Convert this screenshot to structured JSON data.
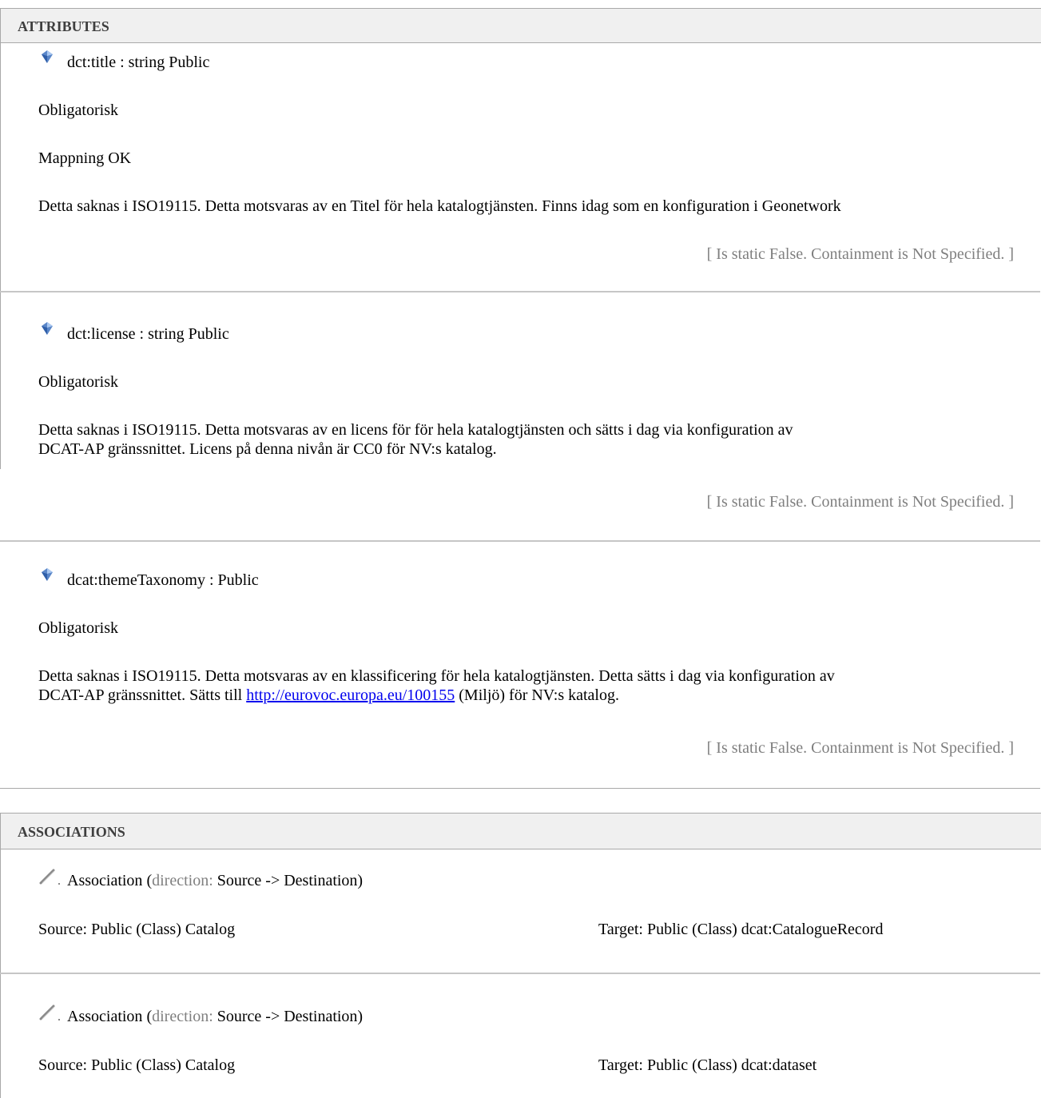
{
  "attributes": {
    "header": "ATTRIBUTES",
    "items": [
      {
        "signature": "dct:title : string  Public",
        "required": "Obligatorisk",
        "mapping": "Mappning OK",
        "description": "Detta saknas i ISO19115. Detta motsvaras av en Titel för hela katalogtjänsten. Finns idag som en konfiguration i Geonetwork",
        "meta": "[ Is static False. Containment is Not Specified. ]"
      },
      {
        "signature": "dct:license : string  Public",
        "required": "Obligatorisk",
        "description_line1": "Detta saknas i ISO19115. Detta motsvaras av en licens för för hela katalogtjänsten och sätts i dag via konfiguration av",
        "description_line2": "DCAT-AP gränssnittet. Licens på denna nivån är CC0 för NV:s katalog.",
        "meta": "[ Is static False. Containment is Not Specified. ]"
      },
      {
        "signature": "dcat:themeTaxonomy :   Public",
        "required": "Obligatorisk",
        "description_line1": "Detta saknas i ISO19115. Detta motsvaras av en klassificering för hela katalogtjänsten. Detta sätts i dag via konfiguration av",
        "description_line2_prefix": "DCAT-AP gränssnittet. Sätts till ",
        "link": "http://eurovoc.europa.eu/100155",
        "description_line2_suffix": "  (Miljö) för NV:s katalog.",
        "meta": "[ Is static False. Containment is Not Specified. ]"
      }
    ]
  },
  "associations": {
    "header": "ASSOCIATIONS",
    "items": [
      {
        "label": "Association",
        "dir_open": " (",
        "dir_key": "direction:",
        "dir_value": " Source -> Destination)",
        "source": "Source: Public (Class) Catalog",
        "target": "Target: Public (Class) dcat:CatalogueRecord"
      },
      {
        "label": "Association",
        "dir_open": " (",
        "dir_key": "direction:",
        "dir_value": " Source -> Destination)",
        "source": "Source: Public (Class) Catalog",
        "target": "Target: Public (Class) dcat:dataset"
      }
    ]
  }
}
